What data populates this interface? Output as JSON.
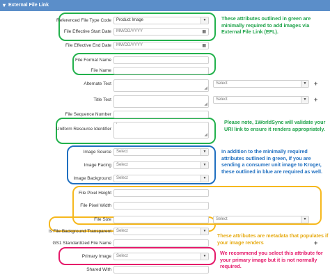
{
  "section_title": "External File Link",
  "date_placeholder": "MM/DD/YYYY",
  "select_placeholder": "Select",
  "fields": {
    "ref_file_type_code": {
      "label": "Referenced File Type Code",
      "value": "Product Image"
    },
    "effective_start": {
      "label": "File Effective Start Date"
    },
    "effective_end": {
      "label": "File Effective End Date"
    },
    "format_name": {
      "label": "File Format Name"
    },
    "file_name": {
      "label": "File Name"
    },
    "alternate_text": {
      "label": "Alternate Text"
    },
    "title_text": {
      "label": "Title Text"
    },
    "sequence_number": {
      "label": "File Sequence Number"
    },
    "uri": {
      "label": "Uniform Resource Identifier",
      "value": "'"
    },
    "image_source": {
      "label": "Image Source"
    },
    "image_facing": {
      "label": "Image Facing"
    },
    "image_background": {
      "label": "Image Background"
    },
    "pixel_height": {
      "label": "File Pixel Height"
    },
    "pixel_width": {
      "label": "File Pixel Width"
    },
    "file_size": {
      "label": "File Size"
    },
    "bg_transparent": {
      "label": "Is File Background Transparent"
    },
    "gs1_file_name": {
      "label": "GS1 Standardized File Name"
    },
    "primary_image": {
      "label": "Primary Image"
    },
    "shared_with": {
      "label": "Shared With"
    }
  },
  "notes": {
    "green": "These attributes outlined in green are minimally required to add images via External File Link (EFL).",
    "uri": "Please note, 1WorldSync will validate your URI link to ensure it renders appropriately.",
    "blue": "In addition to the minimally required attributes outlined in green, if you are sending a consumer unit image to Kroger, these outlined in blue are required as well.",
    "yellow": "These attributes are metadata that populates if your image renders",
    "pink": "We recommend you select this attribute for your primary image but it is not normally required."
  },
  "colors": {
    "header": "#5b8ec9",
    "green": "#22b14c",
    "blue": "#1f6fc0",
    "yellow": "#f6b81d",
    "pink": "#e5196a"
  }
}
